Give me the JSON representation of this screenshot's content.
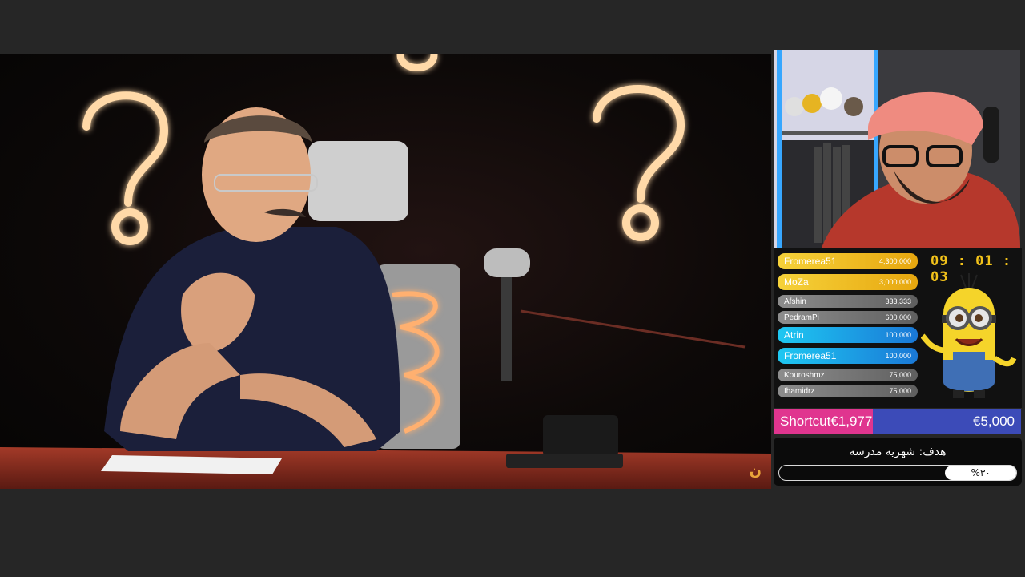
{
  "donation_list": [
    {
      "name": "Fromerea51",
      "amount": "4,300,000",
      "tier": "gold"
    },
    {
      "name": "MoZa",
      "amount": "3,000,000",
      "tier": "gold"
    },
    {
      "name": "Afshin",
      "amount": "333,333",
      "tier": "gray"
    },
    {
      "name": "PedramPi",
      "amount": "600,000",
      "tier": "gray"
    },
    {
      "name": "Atrin",
      "amount": "100,000",
      "tier": "blue"
    },
    {
      "name": "Fromerea51",
      "amount": "100,000",
      "tier": "blue"
    },
    {
      "name": "Kouroshmz",
      "amount": "75,000",
      "tier": "gray"
    },
    {
      "name": "Ihamidrz",
      "amount": "75,000",
      "tier": "gray"
    }
  ],
  "timer": "09 : 01 : 03",
  "shortcut": {
    "label": "Shortcut",
    "current": "€1,977.90",
    "target": "€5,000",
    "progress_fraction": 0.4
  },
  "goal": {
    "title": "هدف: شهریه مدرسه",
    "percent_label": "%۳۰",
    "progress_fraction": 0.3
  },
  "colors": {
    "gold": "#f2c21a",
    "pink": "#e0358f",
    "blue": "#3c4bb8",
    "cyan": "#1ec8f2"
  },
  "video_logo": "ن"
}
